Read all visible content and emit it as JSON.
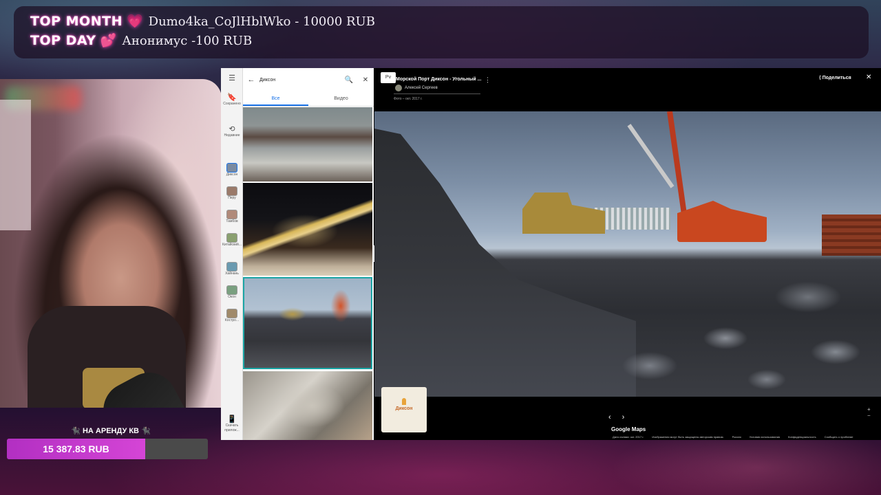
{
  "donations": {
    "top_month": {
      "title": "TOP MONTH",
      "text": "Dumo4ka_CoJlHblWko - 10000 RUB"
    },
    "top_day": {
      "title": "TOP DAY",
      "text": "Анонимус -100 RUB"
    }
  },
  "goal": {
    "label": "🐈‍⬛ НА АРЕНДУ КВ 🐈‍⬛",
    "amount": "15 387.83 RUB",
    "progress_percent": 69
  },
  "maps": {
    "rail": [
      {
        "icon": "bookmark-icon",
        "label": "Сохранено"
      },
      {
        "icon": "history-icon",
        "label": "Недавние"
      },
      {
        "label": "Диксон"
      },
      {
        "label": "Пeру"
      },
      {
        "label": "Тамбов"
      },
      {
        "label": "Китайский..."
      },
      {
        "label": "Хайнань"
      },
      {
        "label": "Окон"
      },
      {
        "label": "Костро..."
      },
      {
        "icon": "phone-icon",
        "label": "Скачать прилож..."
      }
    ],
    "search": {
      "query": "Диксон"
    },
    "tabs": [
      "Все",
      "Видео"
    ],
    "viewer": {
      "badge": "Pv",
      "title": "Морской Порт Диксон - Угольный ...",
      "author": "Алексей Сергеев",
      "date": "Фото – окт. 2017 г.",
      "share": "Поделиться",
      "minimap_label": "Диксон"
    },
    "logo": "Google Maps",
    "footer": [
      "Дата съемки: окт. 2017 г.",
      "Изображения могут быть защищены авторским правом.",
      "Россия",
      "Условия использования",
      "Конфиденциальность",
      "Сообщить о проблеме"
    ]
  }
}
